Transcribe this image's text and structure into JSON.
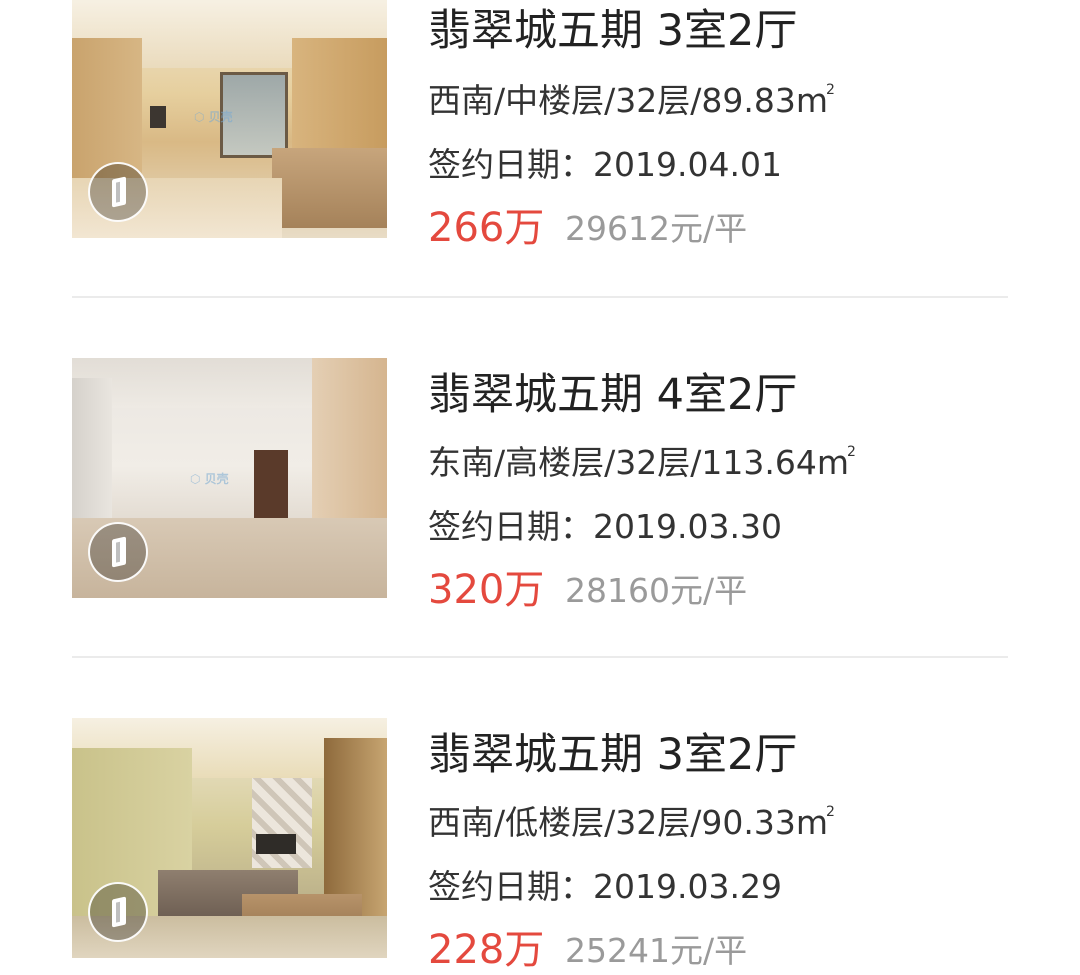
{
  "listings": [
    {
      "title": "翡翠城五期 3室2厅",
      "info": "西南/中楼层/32层/89.83m",
      "info_sup": "2",
      "date": "签约日期：2019.04.01",
      "price": "266万",
      "unit_price": "29612元/平"
    },
    {
      "title": "翡翠城五期 4室2厅",
      "info": "东南/高楼层/32层/113.64m",
      "info_sup": "2",
      "date": "签约日期：2019.03.30",
      "price": "320万",
      "unit_price": "28160元/平"
    },
    {
      "title": "翡翠城五期 3室2厅",
      "info": "西南/低楼层/32层/90.33m",
      "info_sup": "2",
      "date": "签约日期：2019.03.29",
      "price": "228万",
      "unit_price": "25241元/平"
    }
  ],
  "colors": {
    "price": "#e4493e",
    "unit_price": "#9a9a9a",
    "text": "#333333",
    "divider": "#ebebeb"
  },
  "icons": {
    "vr_badge": "vr-view-icon"
  }
}
